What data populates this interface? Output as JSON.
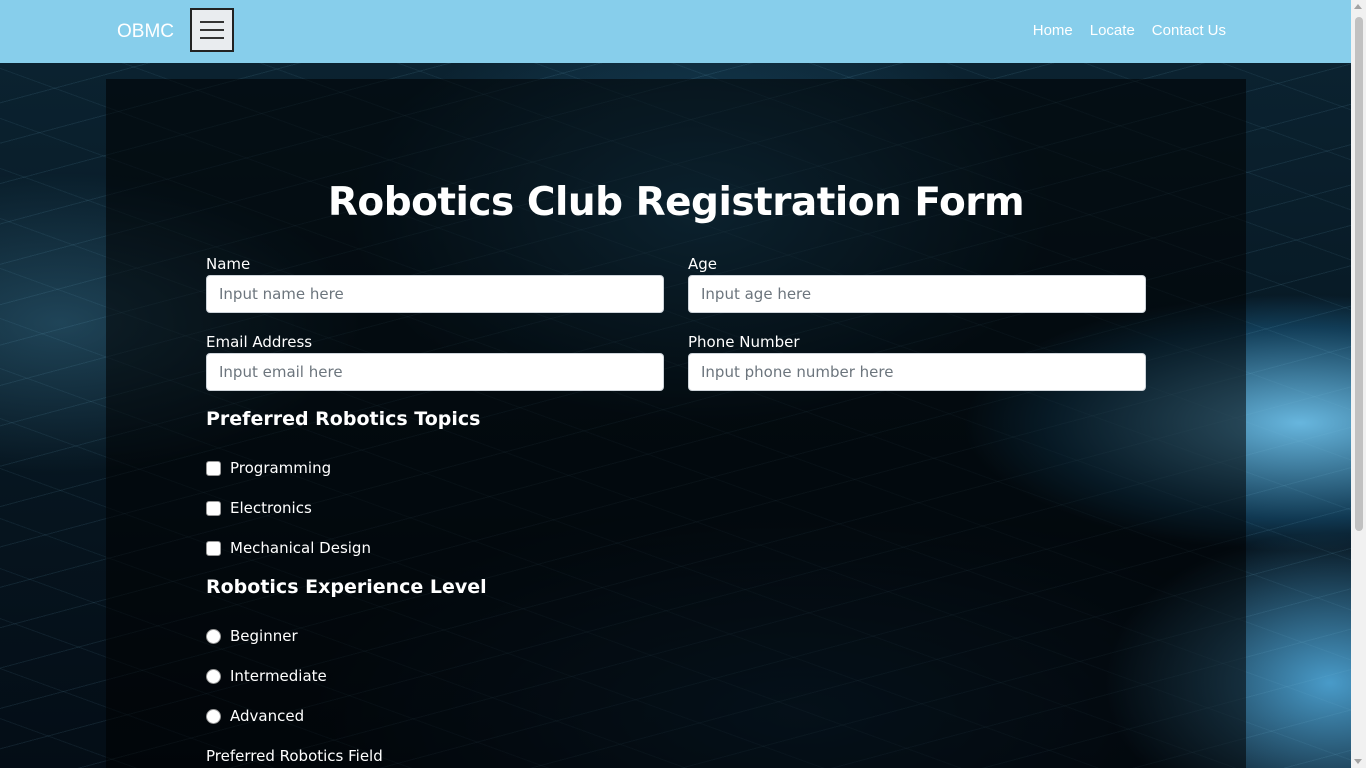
{
  "nav": {
    "brand": "OBMC",
    "links": [
      "Home",
      "Locate",
      "Contact Us"
    ]
  },
  "form": {
    "title": "Robotics Club Registration Form",
    "name_label": "Name",
    "name_placeholder": "Input name here",
    "age_label": "Age",
    "age_placeholder": "Input age here",
    "email_label": "Email Address",
    "email_placeholder": "Input email here",
    "phone_label": "Phone Number",
    "phone_placeholder": "Input phone number here",
    "topics_heading": "Preferred Robotics Topics",
    "topics": [
      "Programming",
      "Electronics",
      "Mechanical Design"
    ],
    "experience_heading": "Robotics Experience Level",
    "experience_levels": [
      "Beginner",
      "Intermediate",
      "Advanced"
    ],
    "field_label": "Preferred Robotics Field"
  },
  "colors": {
    "navbar": "#87ceeb",
    "panel_overlay": "rgba(0,0,0,0.55)",
    "text": "#ffffff"
  }
}
